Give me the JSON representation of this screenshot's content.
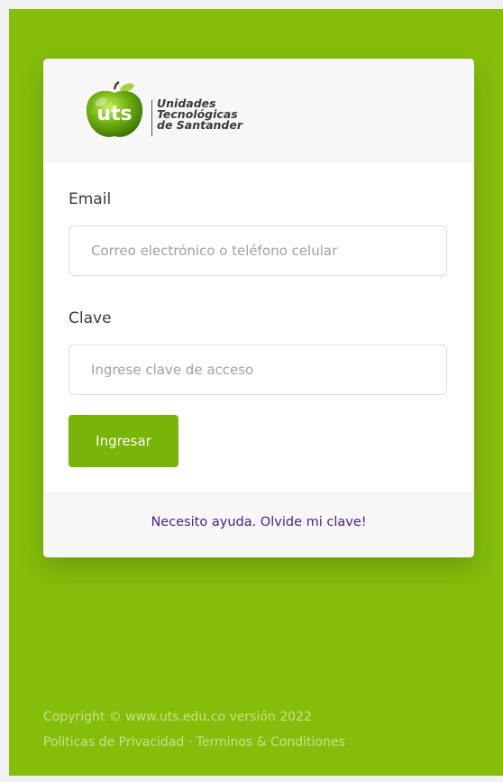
{
  "brand": {
    "logo_mark": "uts",
    "name_line1": "Unidades",
    "name_line2": "Tecnológicas",
    "name_line3": "de Santander",
    "primary_color": "#84be0b",
    "button_color": "#78b508",
    "link_color": "#4b1f8c"
  },
  "form": {
    "email_label": "Email",
    "email_placeholder": "Correo electrónico o teléfono celular",
    "email_value": "",
    "password_label": "Clave",
    "password_placeholder": "Ingrese clave de acceso",
    "password_value": "",
    "submit_label": "Ingresar"
  },
  "help": {
    "link_text": "Necesito ayuda. Olvide mi clave!"
  },
  "footer": {
    "copyright": "Copyright © www.uts.edu.co versión 2022",
    "privacy_link": "Politicas de Privacidad",
    "separator": " · ",
    "terms_link": "Terminos & Conditiones"
  }
}
